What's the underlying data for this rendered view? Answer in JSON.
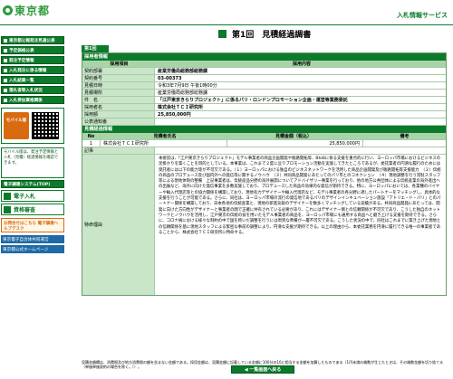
{
  "header": {
    "logo_text": "東京都",
    "service_title": "入札情報サービス"
  },
  "sidebar": {
    "items": [
      {
        "label": "東京都公報発注見通公表"
      },
      {
        "label": "予定価格公表"
      },
      {
        "label": "発注予定情報"
      },
      {
        "label": "入札発注に係る情報"
      },
      {
        "label": "入札結果一覧"
      },
      {
        "label": "落札者等入札状況"
      },
      {
        "label": "入札参加資格関係"
      }
    ],
    "mobile_label": "モバイル版",
    "note": "モバイル版は、発注予定情報と入札（見積）経過情報を確認できます。",
    "systems": [
      {
        "label": "電子調達システム(TOP)"
      },
      {
        "label": "電子入札"
      },
      {
        "label": "資格審査"
      }
    ],
    "ask_label": "お問合せはこちら 電子調達ヘルプデスク",
    "links": [
      {
        "label": "東京電子自治体共同運営"
      },
      {
        "label": "東京都公式ホームページ"
      }
    ]
  },
  "main": {
    "page_title": "第1回　見積経過調書",
    "round_tab": "第1回",
    "sections": {
      "purchase": "採用者情報",
      "estimate": "見積経過情報"
    },
    "table_head": {
      "k": "採用項目",
      "v": "採用内容"
    },
    "rows": [
      {
        "k": "契約部署",
        "v": "産業労働局総務部総務課"
      },
      {
        "k": "契約番号",
        "v": "03-00373"
      },
      {
        "k": "見積日時",
        "v": "令和3年7月9日 午後1時00分"
      },
      {
        "k": "見積場所",
        "v": "産業労働局総務部総務課"
      },
      {
        "k": "件　名",
        "v": "「江戸東京きらりプロジェクト」に係るパリ・ロンドンプロモーション企画・運営等業務委託"
      },
      {
        "k": "採用者名",
        "v": "株式会社ＴＣＩ研究所"
      },
      {
        "k": "採用額",
        "v": "25,850,000円"
      },
      {
        "k": "公表通知番",
        "v": ""
      }
    ],
    "estimate_head": {
      "no": "No",
      "name": "見積者氏名",
      "amount": "見積金額（税込）",
      "note": "備考"
    },
    "estimate_rows": [
      {
        "no": "1",
        "name": "株式会社ＴＣＩ研究所",
        "amount": "25,850,000円",
        "note": ""
      }
    ],
    "remarks_label": "記事",
    "special_label": "特命理由",
    "special_text": "本委託は、「江戸東京きらりプロジェクト」モデル事業者の商品企画開発や販路開拓等、BtoBに係る支援を重点的に行い、ヨーロッパ市場におけるビジネスの足掛かりを築くことを目的としている。本事業は、これまで２度に亘りプロモーション活動を実施してきたところであるが、委託業者の円滑な履行のためには受託者には以下の能力等が不可欠である。（１）ヨーロッパにおける独自のビジネスネットワークを活用した商品企画開発及び販路開拓等支援能力　（２）伝統の商品のプロデュース及び国内外への発信等に関するノウハウ　（３）共同商品開発にあたってのパリ市とのコネクション　（４）現地調整を行う常駐スタッフ等による現地体制の整備　上記事業者は、伝統産品分野の海外展開についてアドバイザリー事業を行っており、他の地方公共団体による伝統産業の海外進出への出展など、海外に向けた発信事業を多数実施しており、プロデュースした商品の効果的な発信が期待できる。特に、ヨーロッパにおいては、各業種のバイヤーや輸入代理店等との協力関係を構築しており、現地有力デザイナーや輸入代理店など、モデル事業者の各分野に適したパートナーをマッチングし、具体的な支援を行うことが可能である。さらに、同社は、ヨーロッパ市場の流行の発信地であるパリのデザインインキュベーション施設「アトリエ・ド・パリ」とのパートナー関係を構築しており、日本各地の伝統産業と、現地の新進気鋭のデザイナーを数多くマッチングしている実績がある。共同商品開発にあたっては、開発に向けた方向性がデザイナーと事業者の間で正確に共有されている必要があり、これにはデザイナー側との信頼関係が不可欠であり、こうした独自のネットワークとノウハウを活用し、江戸東京の伝統の技を用いたモデル事業者の商品を、ヨーロッパ市場にも通用する商品へと磨き上げる支援を期待できる。さらに、コロナ禍における様々な制約の中で国を跨いだ調整を行うには周到な準備が一層不可欠である。こうした状況の中で、同社はこれまでに築き上げた現地との信頼関係を基に現地スタッフによる緊密な事前の調整により、円滑な支援が期待できる。以上の理由から、本委託業務を円滑に履行できる唯一の事業者であることから、株式会社ＴＣＩ研究所に特命する。",
    "footnote": "見積金額欄は、消費税及び地方消費税の額を含まない金額である。採用金額は、見積金額に記載している金額に100分の10に相当する金額を加算したものである（1円未満の端数が生じたときは、その端数金額を切り捨てる（単価単価契約の場合を除く。））。",
    "back_button": "◀ 一覧画面へ戻る"
  }
}
